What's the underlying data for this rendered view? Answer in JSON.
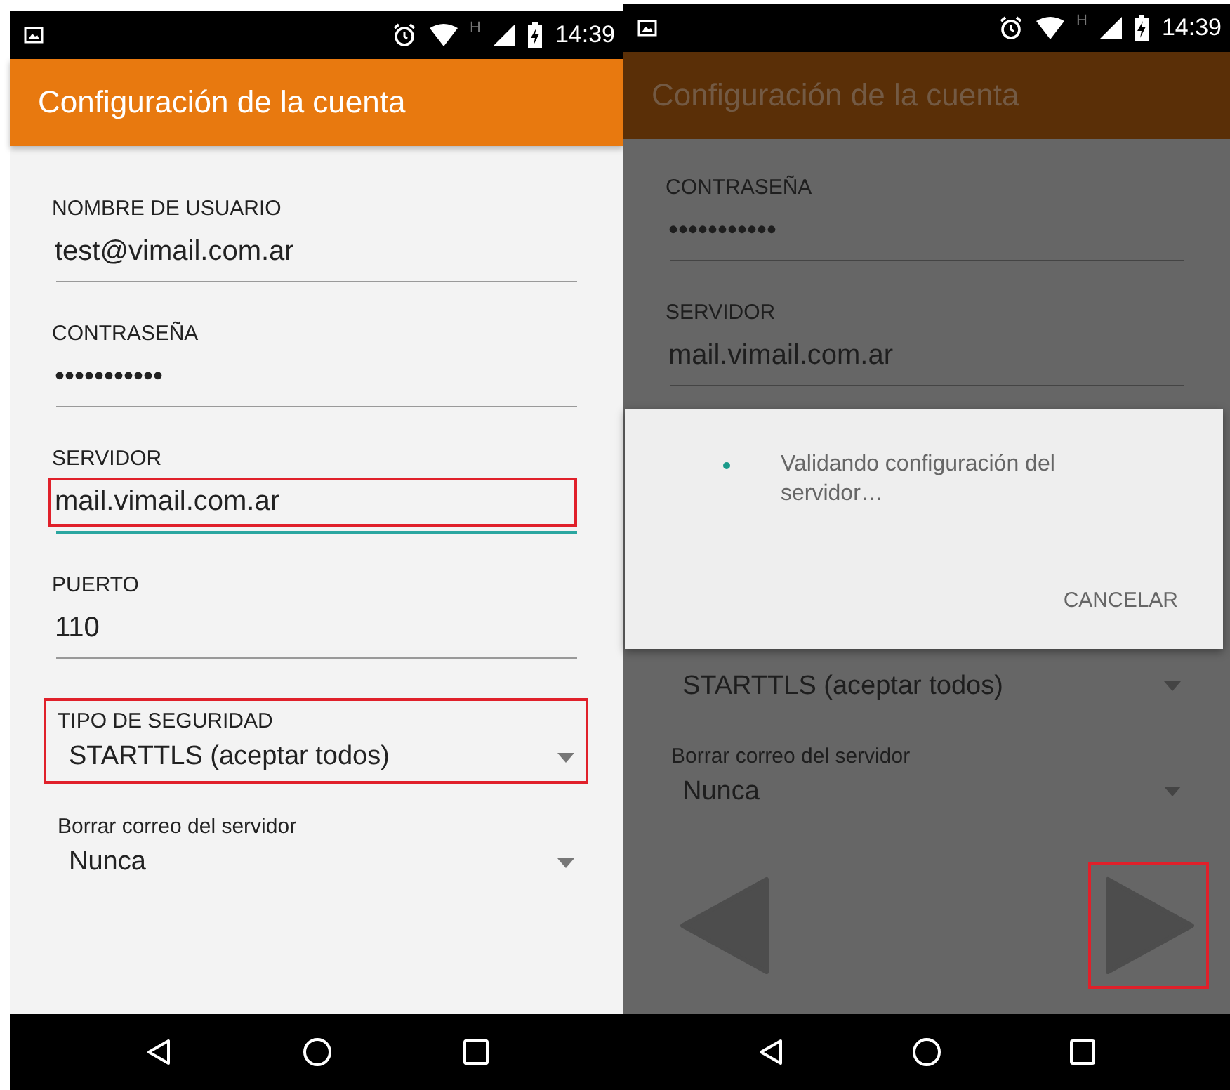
{
  "screens": [
    {
      "dimmed": false,
      "time": "14:39",
      "network": "H",
      "title": "Configuración de la cuenta",
      "fields": [
        {
          "kind": "text",
          "label": "NOMBRE DE USUARIO",
          "value": "test@vimail.com.ar",
          "highlighted": false,
          "focused": false
        },
        {
          "kind": "text",
          "label": "CONTRASEÑA",
          "value": "•••••••••••",
          "highlighted": false,
          "focused": false
        },
        {
          "kind": "text",
          "label": "SERVIDOR",
          "value": "mail.vimail.com.ar",
          "highlighted": true,
          "focused": true
        },
        {
          "kind": "text",
          "label": "PUERTO",
          "value": "110",
          "highlighted": false,
          "focused": false
        },
        {
          "kind": "select",
          "label": "TIPO DE SEGURIDAD",
          "value": "STARTTLS (aceptar todos)",
          "highlighted": true
        },
        {
          "kind": "select",
          "label": "Borrar correo del servidor",
          "value": "Nunca",
          "highlighted": false
        }
      ]
    },
    {
      "dimmed": true,
      "time": "14:39",
      "network": "H",
      "title": "Configuración de la cuenta",
      "fields": [
        {
          "kind": "text",
          "label": "CONTRASEÑA",
          "value": "•••••••••••",
          "highlighted": false,
          "focused": false
        },
        {
          "kind": "text",
          "label": "SERVIDOR",
          "value": "mail.vimail.com.ar",
          "highlighted": false,
          "focused": false
        }
      ],
      "dialog": {
        "message": "Validando configuración del servidor…",
        "button": "CANCELAR"
      },
      "fields_below_dialog": [
        {
          "kind": "select",
          "value": "STARTTLS (aceptar todos)",
          "highlighted": false
        },
        {
          "kind": "select",
          "label": "Borrar correo del servidor",
          "value": "Nunca",
          "highlighted": false
        }
      ],
      "nav_arrows": [
        {
          "kind": "prev",
          "highlighted": false
        },
        {
          "kind": "next",
          "highlighted": true
        }
      ]
    }
  ]
}
